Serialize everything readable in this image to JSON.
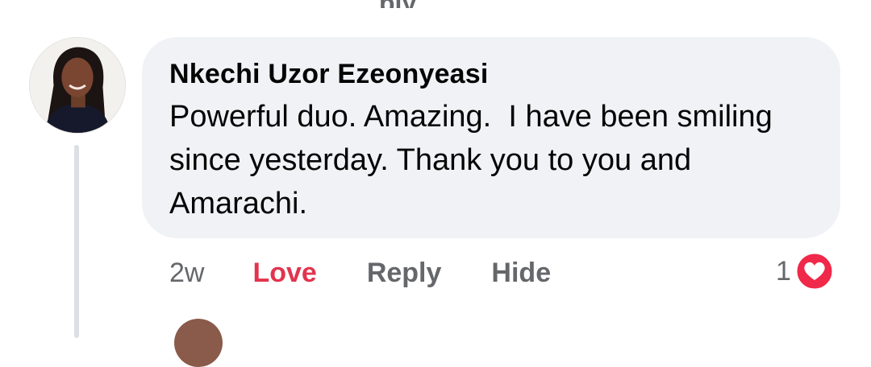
{
  "previous_reply": {
    "fragment": "ply"
  },
  "comment": {
    "author": "Nkechi Uzor Ezeonyeasi",
    "text": "Powerful duo. Amazing.  I have been smiling since yesterday. Thank you to you and Amarachi.",
    "age": "2w",
    "actions": {
      "love": "Love",
      "reply": "Reply",
      "hide": "Hide"
    },
    "reaction": {
      "count": "1",
      "icon": "heart-icon",
      "color": "#f02849"
    }
  },
  "colors": {
    "bubble": "#f0f2f5",
    "love_text": "#e2344f",
    "secondary_text": "#65676b"
  }
}
